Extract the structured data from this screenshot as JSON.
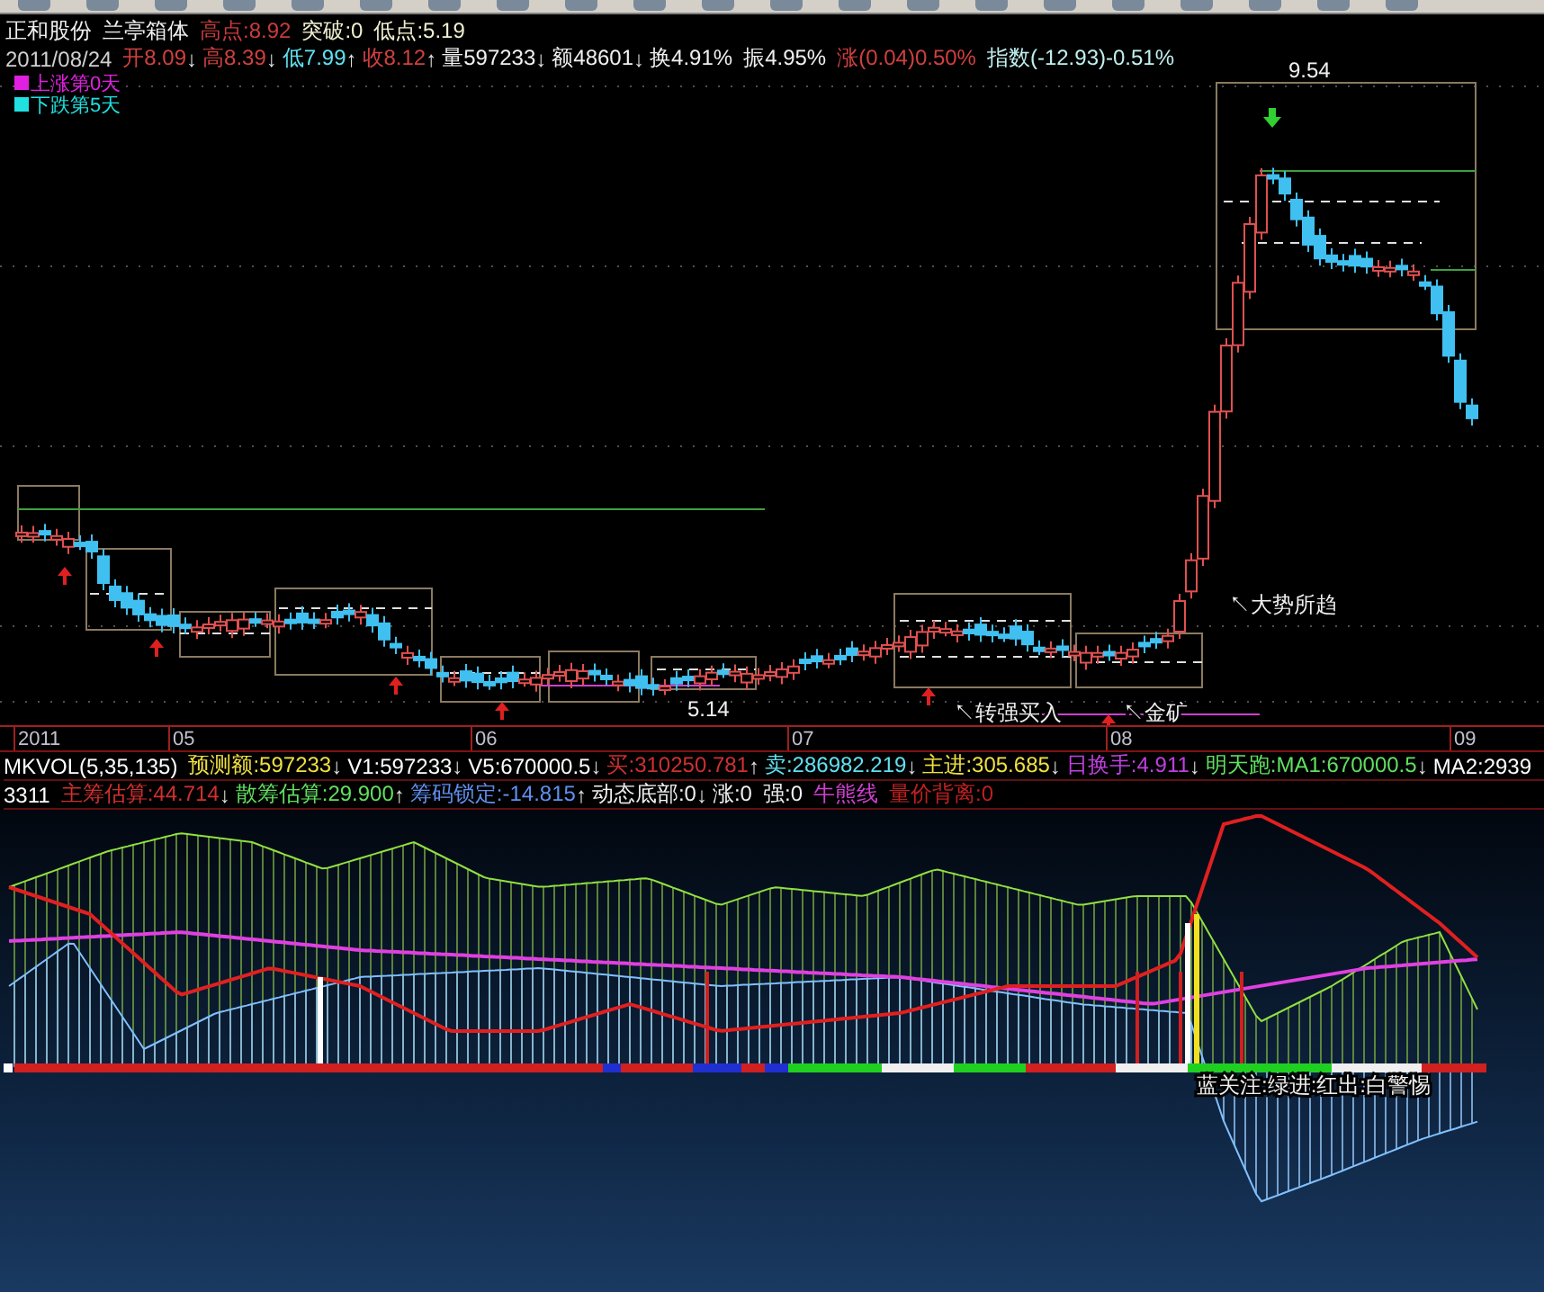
{
  "main_chart": {
    "header_line_1": [
      {
        "text": "正和股份",
        "color": "#f0f0f0"
      },
      {
        "text": "兰亭箱体",
        "color": "#f0f0f0"
      },
      {
        "text": "高点:8.92",
        "color": "#c83c3c"
      },
      {
        "text": "突破:0",
        "color": "#f0f0d0"
      },
      {
        "text": "低点:5.19",
        "color": "#f0f0d0"
      }
    ],
    "header_line_2": [
      {
        "text": "2011/08/24",
        "color": "#d0d0d0"
      },
      {
        "text": "开8.09",
        "arrow": "↓",
        "color": "#d04040"
      },
      {
        "text": "高8.39",
        "arrow": "↓",
        "color": "#d04040"
      },
      {
        "text": "低7.99",
        "arrow": "↑",
        "color": "#60e0f0"
      },
      {
        "text": "收8.12",
        "arrow": "↑",
        "color": "#d04040"
      },
      {
        "text": "量597233",
        "arrow": "↓",
        "color": "#f0f0f0"
      },
      {
        "text": "额48601",
        "arrow": "↓",
        "color": "#f0f0f0"
      },
      {
        "text": "换4.91%",
        "color": "#f0f0f0"
      },
      {
        "text": "振4.95%",
        "color": "#f0f0f0"
      },
      {
        "text": "涨(0.04)0.50%",
        "color": "#d04040"
      },
      {
        "text": "指数(-12.93)-0.51%",
        "color": "#c0f0f0"
      }
    ],
    "legend": [
      {
        "label": "上涨第0天",
        "color": "#e020e0"
      },
      {
        "label": "下跌第5天",
        "color": "#20e0e0"
      }
    ],
    "annotations": [
      "9.54",
      "5.14",
      "↖大势所趋",
      "↖转强买入",
      "↖金矿"
    ],
    "date_axis": [
      "2011",
      "05",
      "06",
      "07",
      "08",
      "09"
    ]
  },
  "indicator": {
    "info_line_1": [
      {
        "text": "MKVOL(5,35,135)"
      },
      {
        "text": "预测额:597233",
        "arrow": "↓",
        "color": "#f0e040"
      },
      {
        "text": "V1:597233",
        "arrow": "↓"
      },
      {
        "text": "V5:670000.5",
        "arrow": "↓"
      },
      {
        "text": "买:310250.781",
        "arrow": "↑",
        "color": "#d03030"
      },
      {
        "text": "卖:286982.219",
        "arrow": "↓",
        "color": "#60e0f0"
      },
      {
        "text": "主进:305.685",
        "arrow": "↓",
        "color": "#f0e040"
      },
      {
        "text": "日换手:4.911",
        "arrow": "↓",
        "color": "#c040e0"
      },
      {
        "text": "明天跑:MA1:670000.5",
        "arrow": "↓",
        "color": "#60e060"
      },
      {
        "text": "MA2:2939"
      }
    ],
    "info_line_2": [
      {
        "text": "3311"
      },
      {
        "text": "主筹估算:44.714",
        "arrow": "↓",
        "color": "#d03030"
      },
      {
        "text": "散筹估算:29.900",
        "arrow": "↑",
        "color": "#60e060"
      },
      {
        "text": "筹码锁定:-14.815",
        "arrow": "↑",
        "color": "#6090f0"
      },
      {
        "text": "动态底部:0",
        "arrow": "↓",
        "color": "#f0f0f0"
      },
      {
        "text": "涨:0",
        "color": "#f0f0f0"
      },
      {
        "text": "强:0",
        "color": "#f0f0f0"
      },
      {
        "text": "牛熊线",
        "color": "#d040d0"
      },
      {
        "text": "量价背离:0",
        "color": "#c02020"
      }
    ],
    "annotation": "蓝关注:绿进:红出:白警惕"
  }
}
